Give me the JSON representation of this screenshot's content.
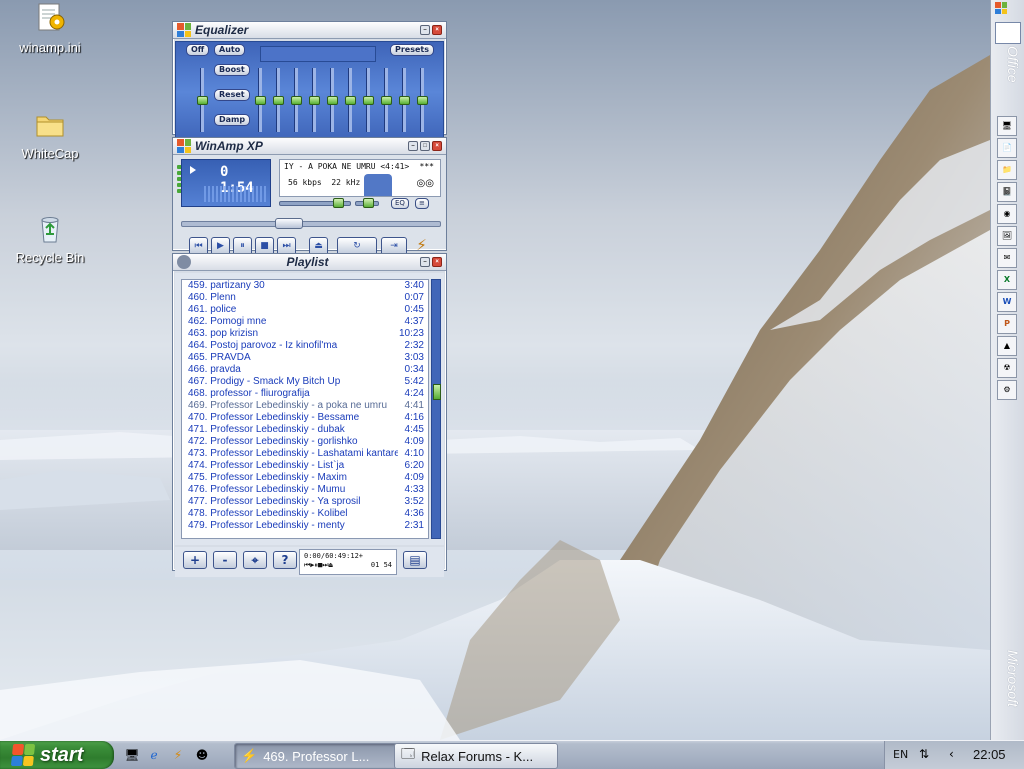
{
  "desktop": {
    "icons": [
      {
        "label": "winamp.ini"
      },
      {
        "label": "WhiteCap"
      },
      {
        "label": "Recycle Bin"
      }
    ]
  },
  "equalizer": {
    "title": "Equalizer",
    "off_label": "Off",
    "auto_label": "Auto",
    "presets_label": "Presets",
    "boost_label": "Boost",
    "reset_label": "Reset",
    "damp_label": "Damp"
  },
  "player": {
    "title": "WinAmp XP",
    "time": "0 1:54",
    "song": "IY - A POKA NE UMRU <4:41>",
    "rating": "***",
    "bitrate": "56 kbps",
    "samplerate": "22 kHz"
  },
  "playlist": {
    "title": "Playlist",
    "items": [
      {
        "name": "459. partizany 30",
        "duration": "3:40"
      },
      {
        "name": "460. Plenn",
        "duration": "0:07"
      },
      {
        "name": "461. police",
        "duration": "0:45"
      },
      {
        "name": "462. Pomogi mne",
        "duration": "4:37"
      },
      {
        "name": "463. pop krizisn",
        "duration": "10:23"
      },
      {
        "name": "464. Postoj parovoz - Iz kinofil'ma",
        "duration": "2:32"
      },
      {
        "name": "465. PRAVDA",
        "duration": "3:03"
      },
      {
        "name": "466. pravda",
        "duration": "0:34"
      },
      {
        "name": "467. Prodigy - Smack My Bitch Up",
        "duration": "5:42"
      },
      {
        "name": "468. professor - fliurografija",
        "duration": "4:24"
      },
      {
        "name": "469. Professor Lebedinskiy - a poka ne umru",
        "duration": "4:41"
      },
      {
        "name": "470. Professor Lebedinskiy - Bessame",
        "duration": "4:16"
      },
      {
        "name": "471. Professor Lebedinskiy - dubak",
        "duration": "4:45"
      },
      {
        "name": "472. Professor Lebedinskiy - gorlishko",
        "duration": "4:09"
      },
      {
        "name": "473. Professor Lebedinskiy - Lashatami kantare",
        "duration": "4:10"
      },
      {
        "name": "474. Professor Lebedinskiy - List`ja",
        "duration": "6:20"
      },
      {
        "name": "475. Professor Lebedinskiy - Maxim",
        "duration": "4:09"
      },
      {
        "name": "476. Professor Lebedinskiy - Mumu",
        "duration": "4:33"
      },
      {
        "name": "477. Professor Lebedinskiy - Ya sprosil",
        "duration": "3:52"
      },
      {
        "name": "478. Professor Lebedinskiy - Kolibel",
        "duration": "4:36"
      },
      {
        "name": "479. Professor Lebedinskiy - menty",
        "duration": "2:31"
      }
    ],
    "add_label": "+",
    "remove_label": "-",
    "select_label": "⌖",
    "misc_label": "?",
    "total_time": "0:00/60:49:12+",
    "track_time": "01 54"
  },
  "office_bar": {
    "top_word": "Office",
    "bottom_word": "Microsoft"
  },
  "taskbar": {
    "start_label": "start",
    "tasks": [
      {
        "label": "469. Professor L...",
        "active": true
      },
      {
        "label": "Relax Forums - K...",
        "active": false
      }
    ],
    "language": "EN",
    "clock": "22:05"
  }
}
